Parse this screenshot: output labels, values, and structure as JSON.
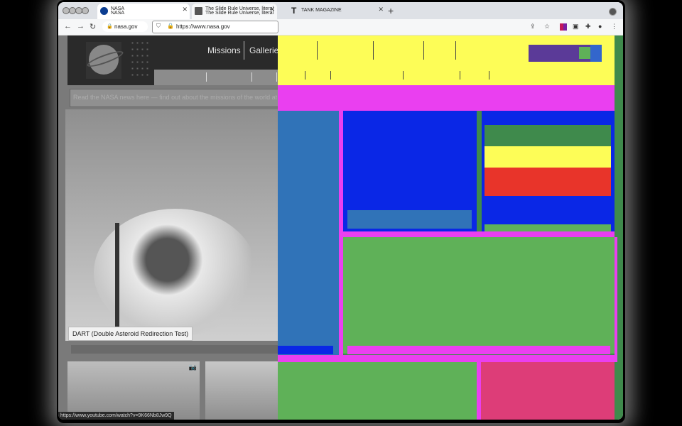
{
  "browser": {
    "tabs": [
      {
        "title": "NASA",
        "overlap_title": "NASA",
        "icon": "nasa-favicon-icon",
        "active": true
      },
      {
        "title": "The Slide Rule Universe, literal",
        "overlap_title": "The Slide Rule Universe, literal",
        "icon": "book-icon"
      },
      {
        "title": "TANK MAGAZINE",
        "icon": "tank-t-icon"
      }
    ],
    "new_tab": "+",
    "address_short": "nasa.gov",
    "address_full": "https://www.nasa.gov",
    "status_url": "https://www.youtube.com/watch?v=9K66Nb8Jw9Q"
  },
  "page": {
    "nav": {
      "missions": "Missions",
      "galleries": "Galleries"
    },
    "banner_text": "Read the NASA news here — find out about the missions of the world at the Slide Rule",
    "hero_caption": "DART (Double Asteroid Redirection Test)"
  },
  "colors": {
    "yellow": "#fdfd57",
    "magenta": "#ea3ff0",
    "blue": "#0a27e6",
    "steel_blue": "#3073b8",
    "green": "#5fb158",
    "dark_green": "#3f8a4c",
    "red": "#e8342a",
    "purple": "#5b3a98",
    "pink": "#dd3d78"
  }
}
